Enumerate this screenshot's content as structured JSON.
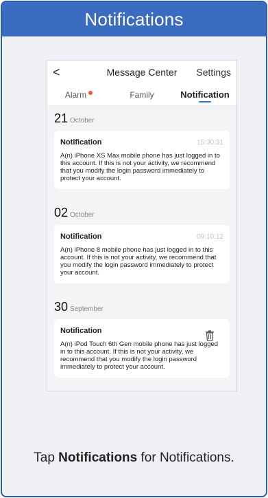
{
  "header": {
    "title": "Notifications"
  },
  "phone": {
    "nav": {
      "back_glyph": "<",
      "title": "Message Center",
      "settings": "Settings"
    },
    "tabs": [
      {
        "label": "Alarm",
        "badge": true
      },
      {
        "label": "Family"
      },
      {
        "label": "Notification",
        "active": true
      }
    ],
    "groups": [
      {
        "day": "21",
        "month": "October",
        "card": {
          "title": "Notification",
          "time": "15:30:31",
          "body": "A(n) iPhone XS Max mobile phone has just logged in to this account. If this is not your activity, we recommend that you modify the login password immediately to protect your account."
        }
      },
      {
        "day": "02",
        "month": "October",
        "card": {
          "title": "Notification",
          "time": "09:10:12",
          "body": "A(n) iPhone 8 mobile phone has just logged in to this account. If this is not your activity, we recommend that you modify the login password immediately to protect your account."
        }
      },
      {
        "day": "30",
        "month": "September",
        "card": {
          "title": "Notification",
          "time": "",
          "body": "A(n) iPod Touch 6th Gen mobile phone has just logged in to this account. If this is not your activity, we recommend that you modify the login password immediately to protect your account."
        }
      }
    ]
  },
  "caption": {
    "prefix": "Tap ",
    "bold": "Notifications",
    "suffix": " for Notifications."
  },
  "colors": {
    "header_bg": "#3a6cc0",
    "accent": "#2f6fe0",
    "badge": "#f05a28"
  }
}
